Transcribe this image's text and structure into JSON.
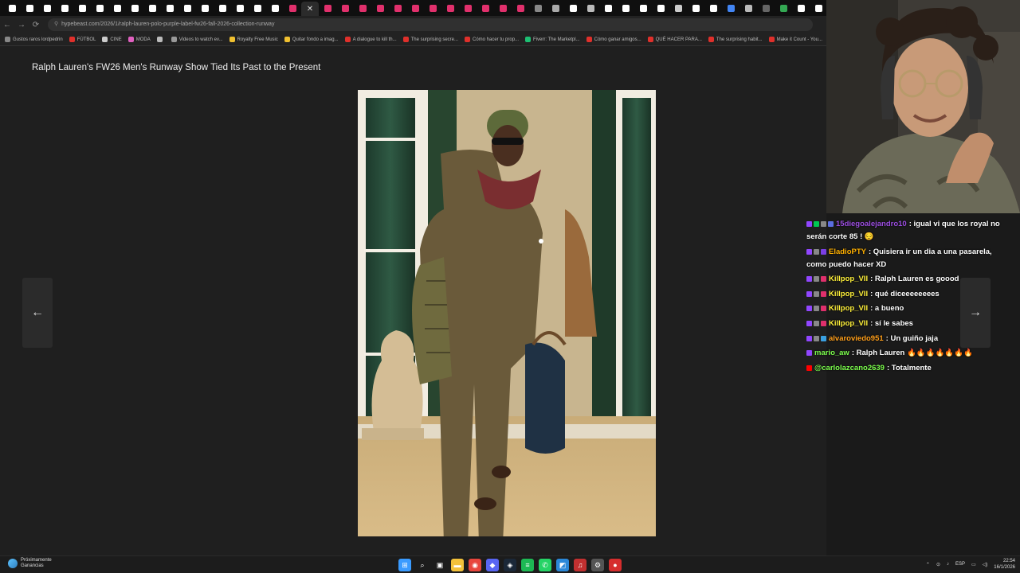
{
  "browser": {
    "tabs": [
      {
        "icon": "hypebeast-favicon",
        "color": "#ffffff"
      },
      {
        "icon": "hypebeast-favicon",
        "color": "#ffffff"
      },
      {
        "icon": "hypebeast-favicon",
        "color": "#ffffff"
      },
      {
        "icon": "hypebeast-favicon",
        "color": "#ffffff"
      },
      {
        "icon": "hypebeast-favicon",
        "color": "#ffffff"
      },
      {
        "icon": "hypebeast-favicon",
        "color": "#ffffff"
      },
      {
        "icon": "hypebeast-favicon",
        "color": "#ffffff"
      },
      {
        "icon": "hypebeast-favicon",
        "color": "#ffffff"
      },
      {
        "icon": "hypebeast-favicon",
        "color": "#ffffff"
      },
      {
        "icon": "hypebeast-favicon",
        "color": "#ffffff"
      },
      {
        "icon": "hypebeast-favicon",
        "color": "#ffffff"
      },
      {
        "icon": "hypebeast-favicon",
        "color": "#ffffff"
      },
      {
        "icon": "hypebeast-favicon",
        "color": "#ffffff"
      },
      {
        "icon": "hypebeast-favicon",
        "color": "#ffffff"
      },
      {
        "icon": "hypebeast-favicon",
        "color": "#ffffff"
      },
      {
        "icon": "hypebeast-favicon",
        "color": "#ffffff"
      },
      {
        "icon": "instagram-favicon",
        "color": "#e1306c"
      },
      {
        "icon": "active-tab-close",
        "color": "#dddddd",
        "active": true
      },
      {
        "icon": "instagram-favicon",
        "color": "#e1306c"
      },
      {
        "icon": "instagram-favicon",
        "color": "#e1306c"
      },
      {
        "icon": "instagram-favicon",
        "color": "#e1306c"
      },
      {
        "icon": "instagram-favicon",
        "color": "#e1306c"
      },
      {
        "icon": "instagram-favicon",
        "color": "#e1306c"
      },
      {
        "icon": "instagram-favicon",
        "color": "#e1306c"
      },
      {
        "icon": "instagram-favicon",
        "color": "#e1306c"
      },
      {
        "icon": "instagram-favicon",
        "color": "#e1306c"
      },
      {
        "icon": "instagram-favicon",
        "color": "#e1306c"
      },
      {
        "icon": "instagram-favicon",
        "color": "#e1306c"
      },
      {
        "icon": "instagram-favicon",
        "color": "#e1306c"
      },
      {
        "icon": "instagram-favicon",
        "color": "#e1306c"
      },
      {
        "icon": "generic-favicon",
        "color": "#888888"
      },
      {
        "icon": "generic-favicon",
        "color": "#aaaaaa"
      },
      {
        "icon": "triangle-favicon",
        "color": "#ffffff"
      },
      {
        "icon": "plus-favicon",
        "color": "#bbbbbb"
      },
      {
        "icon": "generic-favicon",
        "color": "#ffffff"
      },
      {
        "icon": "generic-favicon",
        "color": "#ffffff"
      },
      {
        "icon": "generic-favicon",
        "color": "#ffffff"
      },
      {
        "icon": "generic-favicon",
        "color": "#ffffff"
      },
      {
        "icon": "generic-favicon",
        "color": "#cccccc"
      },
      {
        "icon": "generic-favicon",
        "color": "#ffffff"
      },
      {
        "icon": "generic-favicon",
        "color": "#ffffff"
      },
      {
        "icon": "google-favicon",
        "color": "#4285f4"
      },
      {
        "icon": "generic-favicon",
        "color": "#bbbbbb"
      },
      {
        "icon": "generic-favicon",
        "color": "#666666"
      },
      {
        "icon": "google-favicon",
        "color": "#34a853"
      },
      {
        "icon": "generic-favicon",
        "color": "#ffffff"
      },
      {
        "icon": "generic-favicon",
        "color": "#ffffff"
      },
      {
        "icon": "generic-favicon",
        "color": "#ffffff"
      },
      {
        "icon": "generic-favicon",
        "color": "#ffffff"
      }
    ],
    "url": "hypebeast.com/2026/1/ralph-lauren-polo-purple-label-fw26-fall-2026-collection-runway",
    "bookmarks": [
      {
        "label": "Gustos raros lordpedrin",
        "color": "#888888"
      },
      {
        "label": "FÚTBOL",
        "color": "#e0302b"
      },
      {
        "label": "CINE",
        "color": "#cccccc"
      },
      {
        "label": "MODA",
        "color": "#e060c0"
      },
      {
        "label": "",
        "color": "#bbbbbb"
      },
      {
        "label": "Videos to watch ev...",
        "color": "#999999"
      },
      {
        "label": "Royalty Free Music",
        "color": "#f0c030"
      },
      {
        "label": "Quitar fondo a imag...",
        "color": "#f0c030"
      },
      {
        "label": "A dialogue to kill th...",
        "color": "#e0302b"
      },
      {
        "label": "The surprising secre...",
        "color": "#e0302b"
      },
      {
        "label": "Cómo hacer tu prop...",
        "color": "#e0302b"
      },
      {
        "label": "Fiverr: The Marketpl...",
        "color": "#1dbf73"
      },
      {
        "label": "Cómo ganar amigos...",
        "color": "#e0302b"
      },
      {
        "label": "QUÉ HACER PARA...",
        "color": "#e0302b"
      },
      {
        "label": "The surprising habit...",
        "color": "#e0302b"
      },
      {
        "label": "Make it Count - You...",
        "color": "#e0302b"
      }
    ],
    "nav": {
      "back": "←",
      "forward": "→",
      "reload": "⟳"
    }
  },
  "article": {
    "title": "Ralph Lauren's FW26 Men's Runway Show Tied Its Past to the Present",
    "prev_arrow": "←",
    "next_arrow": "→"
  },
  "chat": [
    {
      "user": "15diegoalejandro10",
      "user_color": "#9b4de0",
      "text": ": igual vi que los royal no serán corte 85 ! 😔",
      "badges": [
        "#9146ff",
        "#00c853",
        "#888888",
        "#5b6ee1"
      ]
    },
    {
      "user": "EladioPTY",
      "user_color": "#ffb000",
      "text": ": Quisiera ir un dia a una pasarela, como puedo hacer XD",
      "badges": [
        "#9146ff",
        "#888888",
        "#7b3fe4"
      ]
    },
    {
      "user": "Killpop_VII",
      "user_color": "#fff13a",
      "text": ": Ralph Lauren es goood",
      "badges": [
        "#9146ff",
        "#888888",
        "#e0306c"
      ]
    },
    {
      "user": "Killpop_VII",
      "user_color": "#fff13a",
      "text": ": qué diceeeeeeees",
      "badges": [
        "#9146ff",
        "#888888",
        "#e0306c"
      ]
    },
    {
      "user": "Killpop_VII",
      "user_color": "#fff13a",
      "text": ": a bueno",
      "badges": [
        "#9146ff",
        "#888888",
        "#e0306c"
      ]
    },
    {
      "user": "Killpop_VII",
      "user_color": "#fff13a",
      "text": ": sí le sabes",
      "badges": [
        "#9146ff",
        "#888888",
        "#e0306c"
      ]
    },
    {
      "user": "alvaroviedo951",
      "user_color": "#ff9f1a",
      "text": ": Un guiño jaja",
      "badges": [
        "#9146ff",
        "#888888",
        "#3aa0e0"
      ]
    },
    {
      "user": "mario_aw",
      "user_color": "#7cff4d",
      "text": ": Ralph Lauren 🔥🔥🔥🔥🔥🔥🔥",
      "badges": [
        "#9146ff"
      ]
    },
    {
      "user": "@carlolazcano2639",
      "user_color": "#7cff4d",
      "text": ": Totalmente",
      "badges": [
        "#ff0000"
      ]
    }
  ],
  "taskbar": {
    "weather_line1": "Próximamente",
    "weather_line2": "Ganancias",
    "apps": [
      {
        "icon": "windows-start-icon",
        "color": "#3a9bff",
        "glyph": "⊞"
      },
      {
        "icon": "search-icon",
        "color": "#1c1c1c",
        "glyph": "⌕"
      },
      {
        "icon": "task-view-icon",
        "color": "#1c1c1c",
        "glyph": "▣"
      },
      {
        "icon": "file-explorer-icon",
        "color": "#f3c13a",
        "glyph": "▬"
      },
      {
        "icon": "chrome-icon",
        "color": "#e8453c",
        "glyph": "◉"
      },
      {
        "icon": "discord-icon",
        "color": "#5865f2",
        "glyph": "◆"
      },
      {
        "icon": "steam-icon",
        "color": "#1b2838",
        "glyph": "◈"
      },
      {
        "icon": "spotify-icon",
        "color": "#1db954",
        "glyph": "≡"
      },
      {
        "icon": "whatsapp-icon",
        "color": "#25d366",
        "glyph": "✆"
      },
      {
        "icon": "photos-icon",
        "color": "#2b88d8",
        "glyph": "◩"
      },
      {
        "icon": "app-icon",
        "color": "#c23030",
        "glyph": "♫"
      },
      {
        "icon": "settings-icon",
        "color": "#555555",
        "glyph": "⚙"
      },
      {
        "icon": "obs-icon",
        "color": "#d62d2d",
        "glyph": "●"
      }
    ],
    "lang": "ESP",
    "time": "22:54",
    "date": "16/1/2026"
  }
}
